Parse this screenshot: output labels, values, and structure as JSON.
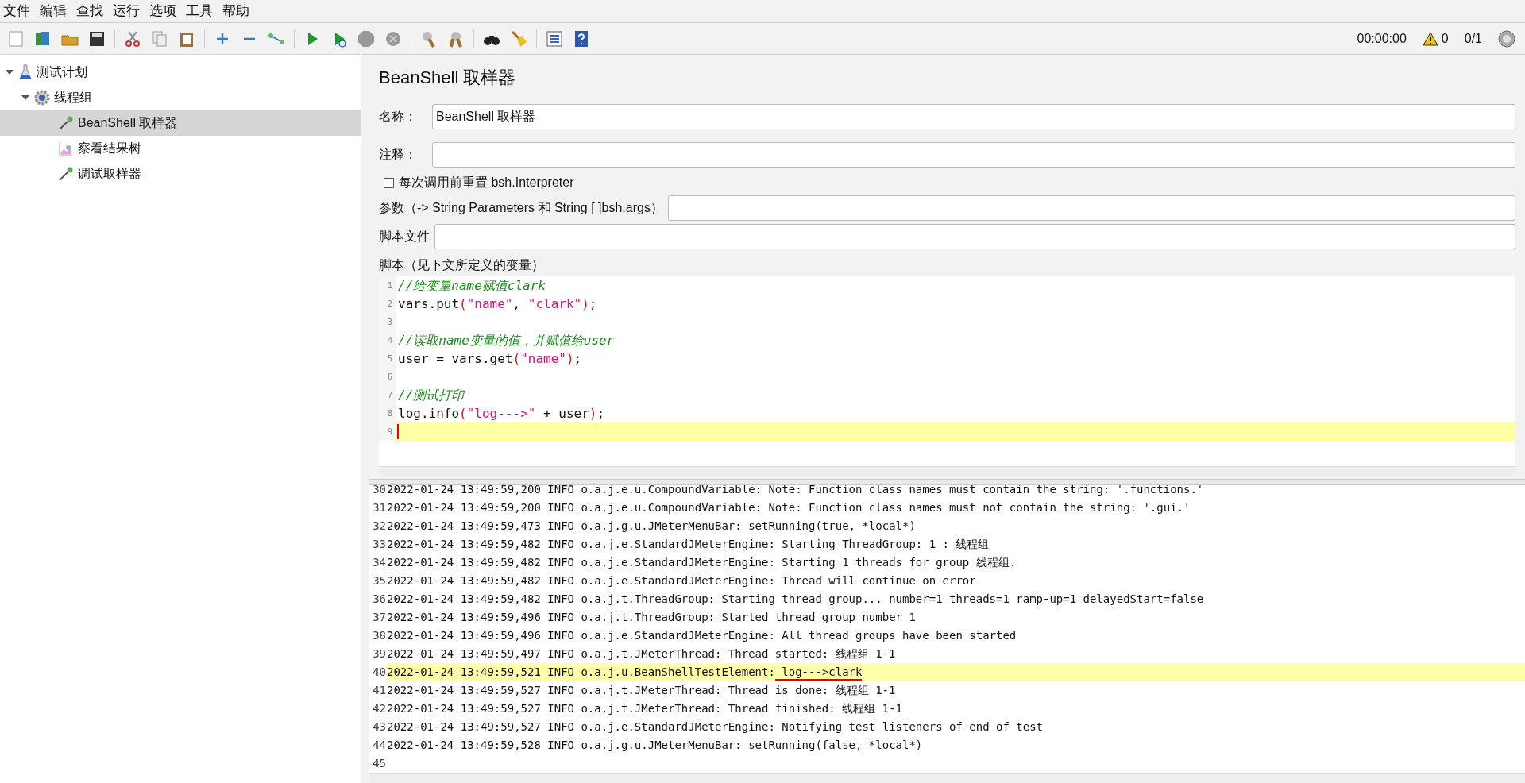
{
  "menu": [
    "文件",
    "编辑",
    "查找",
    "运行",
    "选项",
    "工具",
    "帮助"
  ],
  "status": {
    "timer": "00:00:00",
    "warnings": "0",
    "threads": "0/1"
  },
  "tree": [
    {
      "label": "测试计划",
      "kind": "flask",
      "expanded": true,
      "selected": false,
      "children": [
        {
          "label": "线程组",
          "kind": "gear",
          "expanded": true,
          "selected": false,
          "children": [
            {
              "label": "BeanShell 取样器",
              "kind": "dropper",
              "selected": true
            },
            {
              "label": "察看结果树",
              "kind": "chart",
              "selected": false
            },
            {
              "label": "调试取样器",
              "kind": "dropper",
              "selected": false
            }
          ]
        }
      ]
    }
  ],
  "panel": {
    "title": "BeanShell 取样器",
    "name_label": "名称：",
    "name_value": "BeanShell 取样器",
    "comment_label": "注释：",
    "reset_checkbox": {
      "label": "每次调用前重置 bsh.Interpreter",
      "checked": false
    },
    "params_label": "参数（-> String Parameters 和 String [ ]bsh.args）",
    "script_file_label": "脚本文件",
    "script_label": "脚本（见下文所定义的变量）"
  },
  "code": [
    {
      "number": "1",
      "current": false,
      "tokens": [
        {
          "kind": "comment",
          "text": "//给变量name赋值clark"
        }
      ]
    },
    {
      "number": "2",
      "current": false,
      "tokens": [
        {
          "kind": "plain",
          "text": "vars.put"
        },
        {
          "kind": "paren",
          "text": "("
        },
        {
          "kind": "string",
          "text": "\"name\""
        },
        {
          "kind": "plain",
          "text": ", "
        },
        {
          "kind": "string",
          "text": "\"clark\""
        },
        {
          "kind": "paren",
          "text": ")"
        },
        {
          "kind": "plain",
          "text": ";"
        }
      ]
    },
    {
      "number": "3",
      "current": false
    },
    {
      "number": "4",
      "current": false,
      "tokens": [
        {
          "kind": "comment",
          "text": "//读取name变量的值，并赋值给user"
        }
      ]
    },
    {
      "number": "5",
      "current": false,
      "tokens": [
        {
          "kind": "plain",
          "text": "user = vars.get"
        },
        {
          "kind": "paren",
          "text": "("
        },
        {
          "kind": "string",
          "text": "\"name\""
        },
        {
          "kind": "paren",
          "text": ")"
        },
        {
          "kind": "plain",
          "text": ";"
        }
      ]
    },
    {
      "number": "6",
      "current": false
    },
    {
      "number": "7",
      "current": false,
      "tokens": [
        {
          "kind": "comment",
          "text": "//测试打印"
        }
      ]
    },
    {
      "number": "8",
      "current": false,
      "tokens": [
        {
          "kind": "plain",
          "text": "log.info"
        },
        {
          "kind": "paren",
          "text": "("
        },
        {
          "kind": "string",
          "text": "\"log--->\""
        },
        {
          "kind": "plain",
          "text": " + user"
        },
        {
          "kind": "paren",
          "text": ")"
        },
        {
          "kind": "plain",
          "text": ";"
        }
      ]
    },
    {
      "number": "9",
      "current": true
    }
  ],
  "log": [
    {
      "number": "30",
      "text": "2022-01-24 13:49:59,200 INFO o.a.j.e.u.CompoundVariable: Note: Function class names must contain the string: '.functions.'",
      "highlighted": false
    },
    {
      "number": "31",
      "text": "2022-01-24 13:49:59,200 INFO o.a.j.e.u.CompoundVariable: Note: Function class names must not contain the string: '.gui.'",
      "highlighted": false
    },
    {
      "number": "32",
      "text": "2022-01-24 13:49:59,473 INFO o.a.j.g.u.JMeterMenuBar: setRunning(true, *local*)",
      "highlighted": false
    },
    {
      "number": "33",
      "text": "2022-01-24 13:49:59,482 INFO o.a.j.e.StandardJMeterEngine: Starting ThreadGroup: 1 : 线程组",
      "highlighted": false
    },
    {
      "number": "34",
      "text": "2022-01-24 13:49:59,482 INFO o.a.j.e.StandardJMeterEngine: Starting 1 threads for group 线程组.",
      "highlighted": false
    },
    {
      "number": "35",
      "text": "2022-01-24 13:49:59,482 INFO o.a.j.e.StandardJMeterEngine: Thread will continue on error",
      "highlighted": false
    },
    {
      "number": "36",
      "text": "2022-01-24 13:49:59,482 INFO o.a.j.t.ThreadGroup: Starting thread group... number=1 threads=1 ramp-up=1 delayedStart=false",
      "highlighted": false
    },
    {
      "number": "37",
      "text": "2022-01-24 13:49:59,496 INFO o.a.j.t.ThreadGroup: Started thread group number 1",
      "highlighted": false
    },
    {
      "number": "38",
      "text": "2022-01-24 13:49:59,496 INFO o.a.j.e.StandardJMeterEngine: All thread groups have been started",
      "highlighted": false
    },
    {
      "number": "39",
      "text": "2022-01-24 13:49:59,497 INFO o.a.j.t.JMeterThread: Thread started: 线程组 1-1",
      "highlighted": false
    },
    {
      "number": "40",
      "text": "2022-01-24 13:49:59,521 INFO o.a.j.u.BeanShellTestElement:",
      "underlined": " log--->clark",
      "highlighted": true
    },
    {
      "number": "41",
      "text": "2022-01-24 13:49:59,527 INFO o.a.j.t.JMeterThread: Thread is done: 线程组 1-1",
      "highlighted": false
    },
    {
      "number": "42",
      "text": "2022-01-24 13:49:59,527 INFO o.a.j.t.JMeterThread: Thread finished: 线程组 1-1",
      "highlighted": false
    },
    {
      "number": "43",
      "text": "2022-01-24 13:49:59,527 INFO o.a.j.e.StandardJMeterEngine: Notifying test listeners of end of test",
      "highlighted": false
    },
    {
      "number": "44",
      "text": "2022-01-24 13:49:59,528 INFO o.a.j.g.u.JMeterMenuBar: setRunning(false, *local*)",
      "highlighted": false
    },
    {
      "number": "45",
      "highlighted": false
    }
  ]
}
